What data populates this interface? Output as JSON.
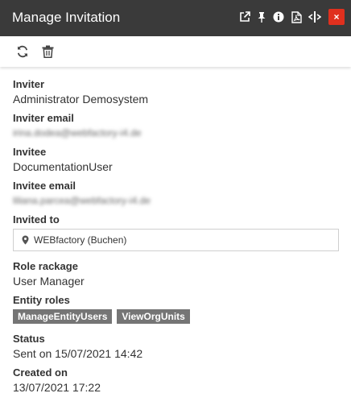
{
  "header": {
    "title": "Manage Invitation",
    "icons": [
      "external-link-icon",
      "pin-icon",
      "info-icon",
      "pdf-icon",
      "resize-icon"
    ],
    "close_label": "×",
    "bg_color": "#3a3a3a",
    "close_color": "#e0301e"
  },
  "toolbar": {
    "icons": [
      "refresh-icon",
      "trash-icon"
    ]
  },
  "fields": {
    "inviter": {
      "label": "Inviter",
      "value": "Administrator Demosystem"
    },
    "inviter_email": {
      "label": "Inviter email",
      "value": "irina.dodea@webfactory-i4.de"
    },
    "invitee": {
      "label": "Invitee",
      "value": "DocumentationUser"
    },
    "invitee_email": {
      "label": "Invitee email",
      "value": "liliana.parcea@webfactory-i4.de"
    },
    "invited_to": {
      "label": "Invited to",
      "value": "WEBfactory (Buchen)"
    },
    "role_package": {
      "label": "Role rackage",
      "value": "User Manager"
    },
    "entity_roles": {
      "label": "Entity roles",
      "chips": [
        "ManageEntityUsers",
        "ViewOrgUnits"
      ]
    },
    "status": {
      "label": "Status",
      "value": "Sent on 15/07/2021 14:42"
    },
    "created_on": {
      "label": "Created on",
      "value": "13/07/2021 17:22"
    }
  }
}
